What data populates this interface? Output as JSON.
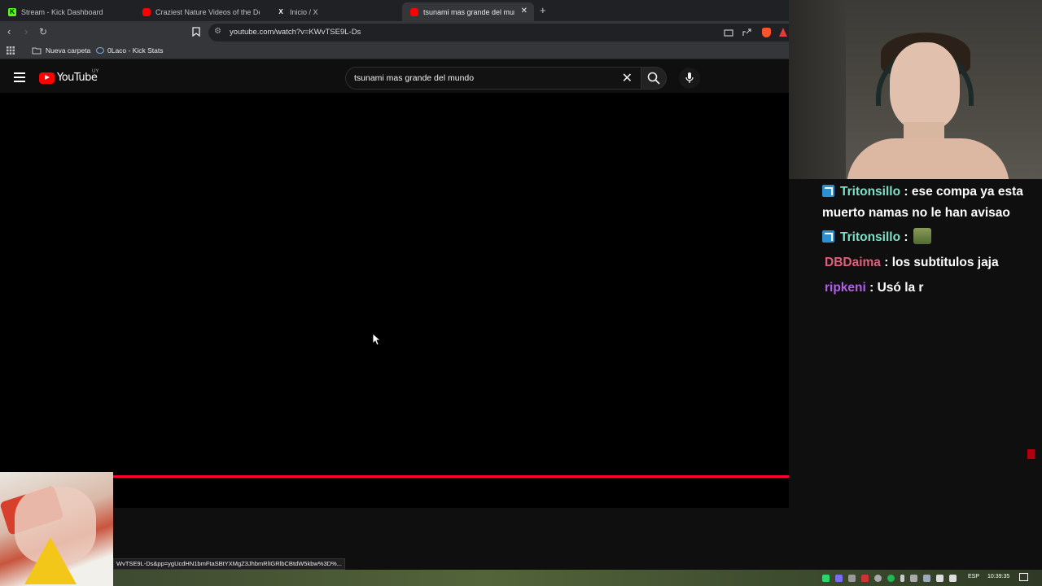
{
  "browser": {
    "tabs": [
      {
        "title": "Stream - Kick Dashboard",
        "favicon": "kick-icon"
      },
      {
        "title": "Craziest Nature Videos of the Decade",
        "favicon": "youtube-icon"
      },
      {
        "title": "Inicio / X",
        "favicon": "x-icon"
      },
      {
        "title": "tsunami mas grande del mundo",
        "favicon": "youtube-icon"
      }
    ],
    "url": "youtube.com/watch?v=KWvTSE9L-Ds",
    "bookmarks": [
      {
        "label": "Nueva carpeta",
        "icon": "folder-icon"
      },
      {
        "label": "0Laco - Kick Stats",
        "icon": "kick-stats-icon"
      }
    ],
    "status_url": "WvTSE9L-Ds&pp=ygUcdHN1bmFtaSBtYXMgZ3JhbmRlIGRlbCBtdW5kbw%3D%..."
  },
  "youtube": {
    "logo_text": "YouTube",
    "country_code": "UY",
    "search_query": "tsunami mas grande del mundo",
    "progress": 0.757,
    "accent": "#ff0033"
  },
  "chat": {
    "messages": [
      {
        "user": "Tritonsillo",
        "color": "#7fe0c8",
        "badge": "verified-badge",
        "text": "ese compa ya esta muerto namas no le han avisao"
      },
      {
        "user": "Tritonsillo",
        "color": "#7fe0c8",
        "badge": "verified-badge",
        "text": "",
        "emote": "emote-icon"
      },
      {
        "user": "DBDaima",
        "color": "#e0607a",
        "badge": "",
        "text": "los subtitulos jaja"
      },
      {
        "user": "ripkeni",
        "color": "#b061e6",
        "badge": "",
        "text": "Usó la r"
      }
    ]
  },
  "taskbar": {
    "language": "ESP",
    "time": "10:39:35"
  }
}
